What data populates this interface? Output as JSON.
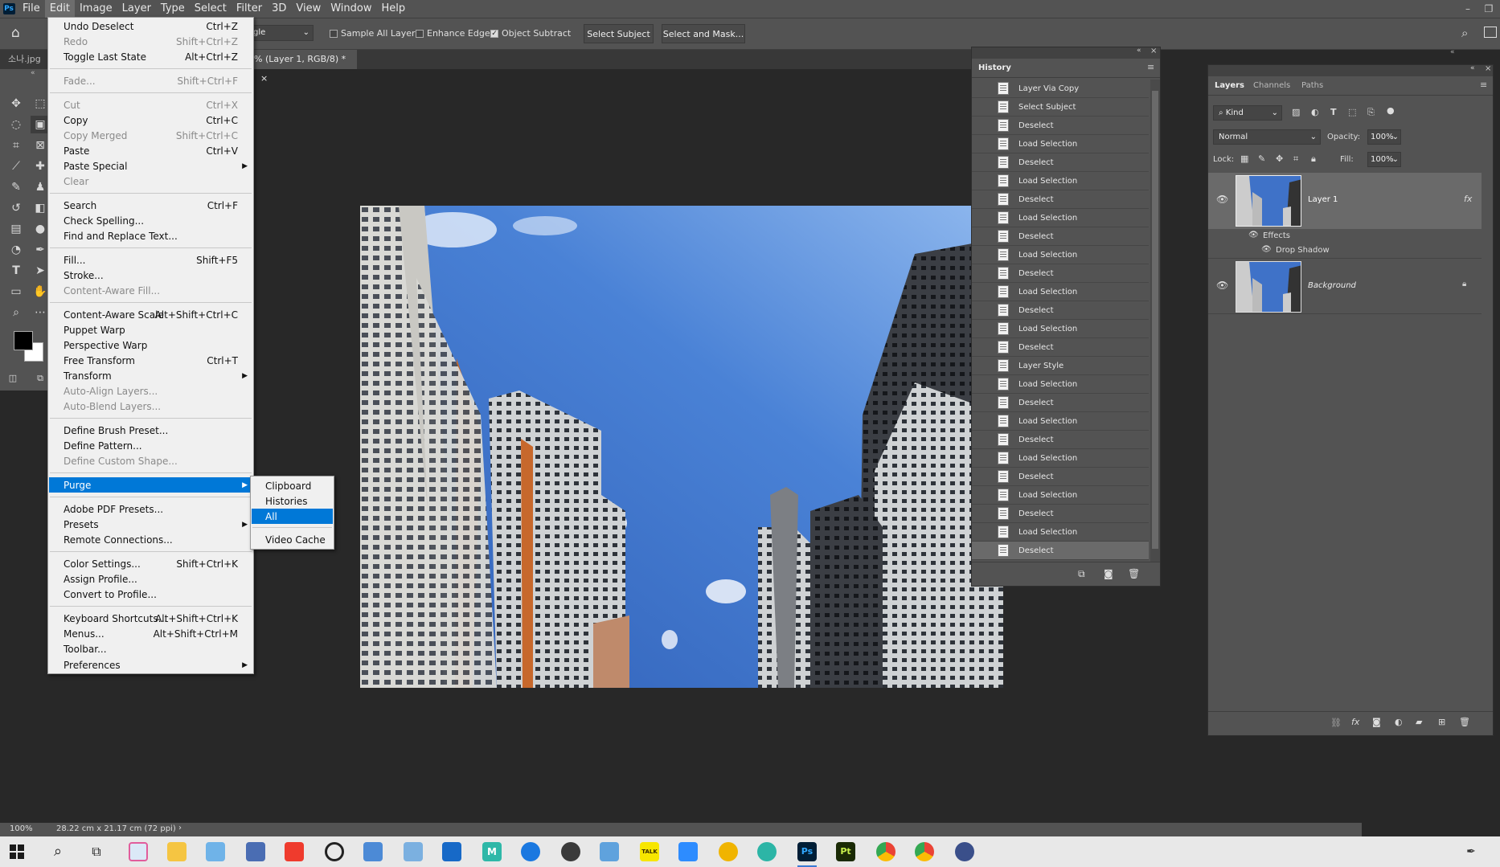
{
  "app": {
    "logo": "Ps",
    "menus": [
      "File",
      "Edit",
      "Image",
      "Layer",
      "Type",
      "Select",
      "Filter",
      "3D",
      "View",
      "Window",
      "Help"
    ]
  },
  "options": {
    "mode_value": "gle",
    "sample_all_layers": "Sample All Layers",
    "enhance_edge": "Enhance Edge",
    "object_subtract": "Object Subtract",
    "select_subject": "Select Subject",
    "select_and_mask": "Select and Mask..."
  },
  "tabs": {
    "left_tab": "소나.jpg",
    "doc_tab": "% (Layer 1, RGB/8) *",
    "close": "×"
  },
  "edit_menu": [
    {
      "label": "Undo Deselect",
      "shortcut": "Ctrl+Z",
      "disabled": false
    },
    {
      "label": "Redo",
      "shortcut": "Shift+Ctrl+Z",
      "disabled": true
    },
    {
      "label": "Toggle Last State",
      "shortcut": "Alt+Ctrl+Z",
      "disabled": false
    },
    {
      "label": "Fade...",
      "shortcut": "Shift+Ctrl+F",
      "disabled": true
    },
    {
      "label": "Cut",
      "shortcut": "Ctrl+X",
      "disabled": true
    },
    {
      "label": "Copy",
      "shortcut": "Ctrl+C",
      "disabled": false
    },
    {
      "label": "Copy Merged",
      "shortcut": "Shift+Ctrl+C",
      "disabled": true
    },
    {
      "label": "Paste",
      "shortcut": "Ctrl+V",
      "disabled": false
    },
    {
      "label": "Paste Special",
      "shortcut": "",
      "disabled": false,
      "submenu": true
    },
    {
      "label": "Clear",
      "shortcut": "",
      "disabled": true
    },
    {
      "label": "Search",
      "shortcut": "Ctrl+F",
      "disabled": false
    },
    {
      "label": "Check Spelling...",
      "shortcut": "",
      "disabled": false
    },
    {
      "label": "Find and Replace Text...",
      "shortcut": "",
      "disabled": false
    },
    {
      "label": "Fill...",
      "shortcut": "Shift+F5",
      "disabled": false
    },
    {
      "label": "Stroke...",
      "shortcut": "",
      "disabled": false
    },
    {
      "label": "Content-Aware Fill...",
      "shortcut": "",
      "disabled": true
    },
    {
      "label": "Content-Aware Scale",
      "shortcut": "Alt+Shift+Ctrl+C",
      "disabled": false
    },
    {
      "label": "Puppet Warp",
      "shortcut": "",
      "disabled": false
    },
    {
      "label": "Perspective Warp",
      "shortcut": "",
      "disabled": false
    },
    {
      "label": "Free Transform",
      "shortcut": "Ctrl+T",
      "disabled": false
    },
    {
      "label": "Transform",
      "shortcut": "",
      "disabled": false,
      "submenu": true
    },
    {
      "label": "Auto-Align Layers...",
      "shortcut": "",
      "disabled": true
    },
    {
      "label": "Auto-Blend Layers...",
      "shortcut": "",
      "disabled": true
    },
    {
      "label": "Define Brush Preset...",
      "shortcut": "",
      "disabled": false
    },
    {
      "label": "Define Pattern...",
      "shortcut": "",
      "disabled": false
    },
    {
      "label": "Define Custom Shape...",
      "shortcut": "",
      "disabled": true
    },
    {
      "label": "Purge",
      "shortcut": "",
      "disabled": false,
      "submenu": true,
      "highlighted": true
    },
    {
      "label": "Adobe PDF Presets...",
      "shortcut": "",
      "disabled": false
    },
    {
      "label": "Presets",
      "shortcut": "",
      "disabled": false,
      "submenu": true
    },
    {
      "label": "Remote Connections...",
      "shortcut": "",
      "disabled": false
    },
    {
      "label": "Color Settings...",
      "shortcut": "Shift+Ctrl+K",
      "disabled": false
    },
    {
      "label": "Assign Profile...",
      "shortcut": "",
      "disabled": false
    },
    {
      "label": "Convert to Profile...",
      "shortcut": "",
      "disabled": false
    },
    {
      "label": "Keyboard Shortcuts...",
      "shortcut": "Alt+Shift+Ctrl+K",
      "disabled": false
    },
    {
      "label": "Menus...",
      "shortcut": "Alt+Shift+Ctrl+M",
      "disabled": false
    },
    {
      "label": "Toolbar...",
      "shortcut": "",
      "disabled": false
    },
    {
      "label": "Preferences",
      "shortcut": "",
      "disabled": false,
      "submenu": true
    }
  ],
  "purge_submenu": [
    {
      "label": "Clipboard",
      "highlighted": false
    },
    {
      "label": "Histories",
      "highlighted": false
    },
    {
      "label": "All",
      "highlighted": true
    },
    {
      "label": "Video Cache",
      "highlighted": false
    }
  ],
  "history": {
    "title": "History",
    "items": [
      "Layer Via Copy",
      "Select Subject",
      "Deselect",
      "Load Selection",
      "Deselect",
      "Load Selection",
      "Deselect",
      "Load Selection",
      "Deselect",
      "Load Selection",
      "Deselect",
      "Load Selection",
      "Deselect",
      "Load Selection",
      "Deselect",
      "Layer Style",
      "Load Selection",
      "Deselect",
      "Load Selection",
      "Deselect",
      "Load Selection",
      "Deselect",
      "Load Selection",
      "Deselect",
      "Load Selection",
      "Deselect"
    ]
  },
  "layers_panel": {
    "tabs": [
      "Layers",
      "Channels",
      "Paths"
    ],
    "kind": "Kind",
    "blend_mode": "Normal",
    "opacity_label": "Opacity:",
    "opacity_value": "100%",
    "lock_label": "Lock:",
    "fill_label": "Fill:",
    "fill_value": "100%",
    "layers": [
      {
        "name": "Layer 1",
        "fx": "fx",
        "effects_label": "Effects",
        "effect": "Drop Shadow"
      },
      {
        "name": "Background"
      }
    ]
  },
  "status": {
    "zoom": "100%",
    "doc_info": "28.22 cm x 21.17 cm (72 ppi)"
  },
  "colors": {
    "accent": "#0078d7",
    "panel": "#535353",
    "canvas_bg": "#282828"
  },
  "taskbar": {
    "icons": [
      "windows-start",
      "search",
      "task-view",
      "paint-app",
      "file-explorer",
      "edge-legacy",
      "calculator",
      "anydesk",
      "q-app",
      "remote-app",
      "screen-app",
      "outlook",
      "m-app",
      "r-app",
      "obs",
      "magnifier",
      "kakaotalk",
      "zoom",
      "norton",
      "edge",
      "photoshop",
      "prelude",
      "chrome",
      "chrome-user",
      "other-app"
    ],
    "ps": "Ps",
    "pt": "Pt",
    "talk": "TALK"
  }
}
